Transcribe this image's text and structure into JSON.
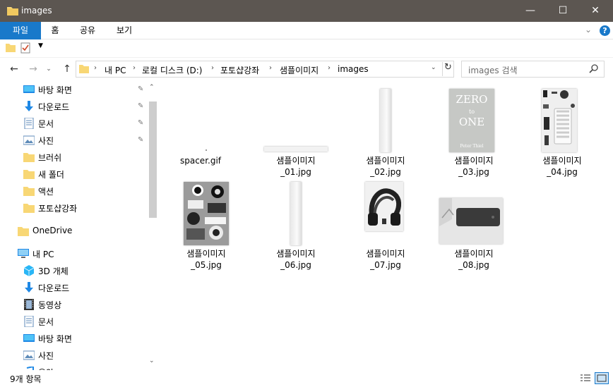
{
  "window": {
    "title": "images",
    "minimize_glyph": "—",
    "maximize_glyph": "☐",
    "close_glyph": "✕"
  },
  "ribbon": {
    "tabs": [
      "파일",
      "홈",
      "공유",
      "보기"
    ],
    "expand_glyph": "⌄",
    "help_glyph": "?"
  },
  "toolbar": {
    "qat_dropdown_glyph": "▼"
  },
  "nav": {
    "back_glyph": "←",
    "forward_glyph": "→",
    "recent_glyph": "⌄",
    "up_glyph": "↑"
  },
  "address": {
    "crumbs": [
      "내 PC",
      "로컬 디스크 (D:)",
      "포토샵강좌",
      "샘플이미지",
      "images"
    ],
    "separator": "›",
    "refresh_glyph": "↻",
    "dropdown_glyph": "⌄"
  },
  "search": {
    "placeholder": "images 검색"
  },
  "sidebar": {
    "quick_access": [
      {
        "label": "바탕 화면",
        "icon": "desktop-icon",
        "pinned": true
      },
      {
        "label": "다운로드",
        "icon": "download-icon",
        "pinned": true
      },
      {
        "label": "문서",
        "icon": "document-icon",
        "pinned": true
      },
      {
        "label": "사진",
        "icon": "pictures-icon",
        "pinned": true
      },
      {
        "label": "브러쉬",
        "icon": "folder-icon",
        "pinned": false
      },
      {
        "label": "새 폴더",
        "icon": "folder-icon",
        "pinned": false
      },
      {
        "label": "액션",
        "icon": "folder-icon",
        "pinned": false
      },
      {
        "label": "포토샵강좌",
        "icon": "folder-icon",
        "pinned": false
      }
    ],
    "onedrive": {
      "label": "OneDrive",
      "icon": "onedrive-folder-icon"
    },
    "this_pc": {
      "label": "내 PC",
      "icon": "computer-icon"
    },
    "this_pc_items": [
      {
        "label": "3D 개체",
        "icon": "3d-objects-icon"
      },
      {
        "label": "다운로드",
        "icon": "download-icon"
      },
      {
        "label": "동영상",
        "icon": "videos-icon"
      },
      {
        "label": "문서",
        "icon": "document-icon"
      },
      {
        "label": "바탕 화면",
        "icon": "desktop-icon"
      },
      {
        "label": "사진",
        "icon": "pictures-icon"
      },
      {
        "label": "음악",
        "icon": "music-icon"
      }
    ],
    "pin_glyph": "📌",
    "scroll_up_glyph": "⌃",
    "scroll_down_glyph": "⌄"
  },
  "files": [
    {
      "name_line1": "spacer.gif",
      "name_line2": ""
    },
    {
      "name_line1": "샘플이미지",
      "name_line2": "_01.jpg"
    },
    {
      "name_line1": "샘플이미지",
      "name_line2": "_02.jpg"
    },
    {
      "name_line1": "샘플이미지",
      "name_line2": "_03.jpg"
    },
    {
      "name_line1": "샘플이미지",
      "name_line2": "_04.jpg"
    },
    {
      "name_line1": "샘플이미지",
      "name_line2": "_05.jpg"
    },
    {
      "name_line1": "샘플이미지",
      "name_line2": "_06.jpg"
    },
    {
      "name_line1": "샘플이미지",
      "name_line2": "_07.jpg"
    },
    {
      "name_line1": "샘플이미지",
      "name_line2": "_08.jpg"
    }
  ],
  "thumb03": {
    "line1": "ZERO",
    "line2": "to",
    "line3": "ONE",
    "author": "Peter Thiel"
  },
  "status": {
    "item_count": "9개 항목"
  },
  "colors": {
    "titlebar": "#5c5651",
    "accent": "#1979ca",
    "folder": "#f8d775"
  }
}
